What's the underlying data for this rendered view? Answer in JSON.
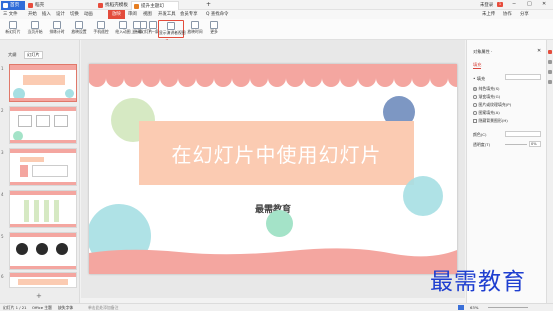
{
  "titlebar": {
    "tabs": [
      {
        "label": "首页"
      },
      {
        "label": "稻壳"
      },
      {
        "label": "找稻壳模板"
      },
      {
        "label": "提升主题幻"
      }
    ],
    "new_tab": "+",
    "right": {
      "login": "未登录",
      "badge": "1"
    },
    "window": {
      "min": "−",
      "max": "□",
      "close": "✕"
    }
  },
  "menubar": {
    "file": "三 文件",
    "items": [
      "开始",
      "插入",
      "设计",
      "切换",
      "动画",
      "放映",
      "审阅",
      "视图",
      "开发工具",
      "会员专享"
    ],
    "search": "Q 查找命令",
    "right": [
      "未上传",
      "协作",
      "分享"
    ],
    "accent": "#d9453c"
  },
  "ribbon": {
    "buttons": [
      {
        "label": "新幻灯片"
      },
      {
        "label": "当页开始"
      },
      {
        "label": "排练计时"
      },
      {
        "label": "放映设置"
      },
      {
        "label": "手机遥控"
      },
      {
        "label": "绘入动图"
      },
      {
        "label": "隐藏幻灯片"
      },
      {
        "label": "上一条"
      },
      {
        "label": "下一条"
      },
      {
        "label": "显示演讲者视图"
      },
      {
        "label": "放映时间"
      },
      {
        "label": "更多"
      }
    ],
    "highlight_color": "#e34c3c"
  },
  "leftpanel": {
    "tabs": [
      "大纲",
      "幻灯片"
    ],
    "slide_numbers": [
      "1",
      "2",
      "3",
      "4",
      "5",
      "6"
    ],
    "add": "+"
  },
  "slide": {
    "title": "在幻灯片中使用幻灯片",
    "subtitle": "最需教育",
    "colors": {
      "scallop": "#f4a6a0",
      "title_box": "#fbcbb2",
      "green": "#d6e9c3",
      "blue": "#6f8cbd",
      "teal": "#a6dfe3",
      "mint": "#a4e3c8"
    }
  },
  "rightpanel": {
    "title": "对象属性 ·",
    "tab": "填充",
    "section": "• 填充",
    "options": [
      "纯色填充(S)",
      "渐变填充(G)",
      "图片或纹理填充(P)",
      "图案填充(A)",
      "隐藏背景图形(H)"
    ],
    "selected_option_index": 0,
    "color_label": "颜色(C)",
    "transparency_label": "透明度(T)",
    "transparency_value": "0%"
  },
  "statusbar": {
    "left": "幻灯片 1 / 21",
    "theme": "Office 主题",
    "missing_font": "缺失字体",
    "notes": "单击此处添加备注",
    "zoom": "63%"
  },
  "watermark": "最需教育"
}
